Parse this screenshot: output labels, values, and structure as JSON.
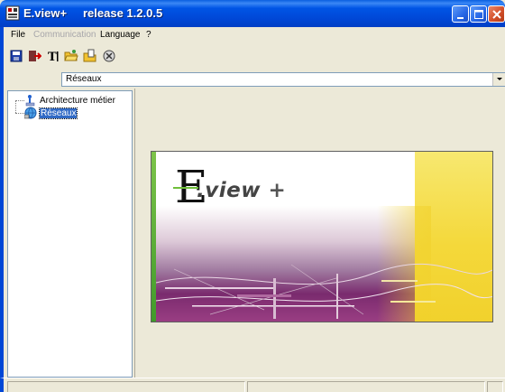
{
  "window": {
    "title": "E.view+",
    "version": "release 1.2.0.5"
  },
  "menu": {
    "items": [
      {
        "label": "File",
        "enabled": true
      },
      {
        "label": "Communication",
        "enabled": false
      },
      {
        "label": "Language",
        "enabled": true
      },
      {
        "label": "?",
        "enabled": true
      }
    ]
  },
  "toolbar": {
    "buttons": [
      "save-icon",
      "exit-icon",
      "text-icon",
      "open-folder-icon",
      "open-file-icon",
      "refresh-icon"
    ]
  },
  "selector": {
    "value": "Réseaux"
  },
  "tree": {
    "items": [
      {
        "label": "Architecture métier",
        "selected": false
      },
      {
        "label": "Réseaux",
        "selected": true
      }
    ]
  },
  "banner": {
    "logo_letter": "E",
    "logo_text": ".view",
    "logo_plus": "+"
  },
  "colors": {
    "titlebar": "#0047d6",
    "selection": "#316ac5",
    "banner_yellow": "#f4d83a",
    "banner_purple": "#7a2b6e",
    "banner_green": "#6fbf3a"
  }
}
